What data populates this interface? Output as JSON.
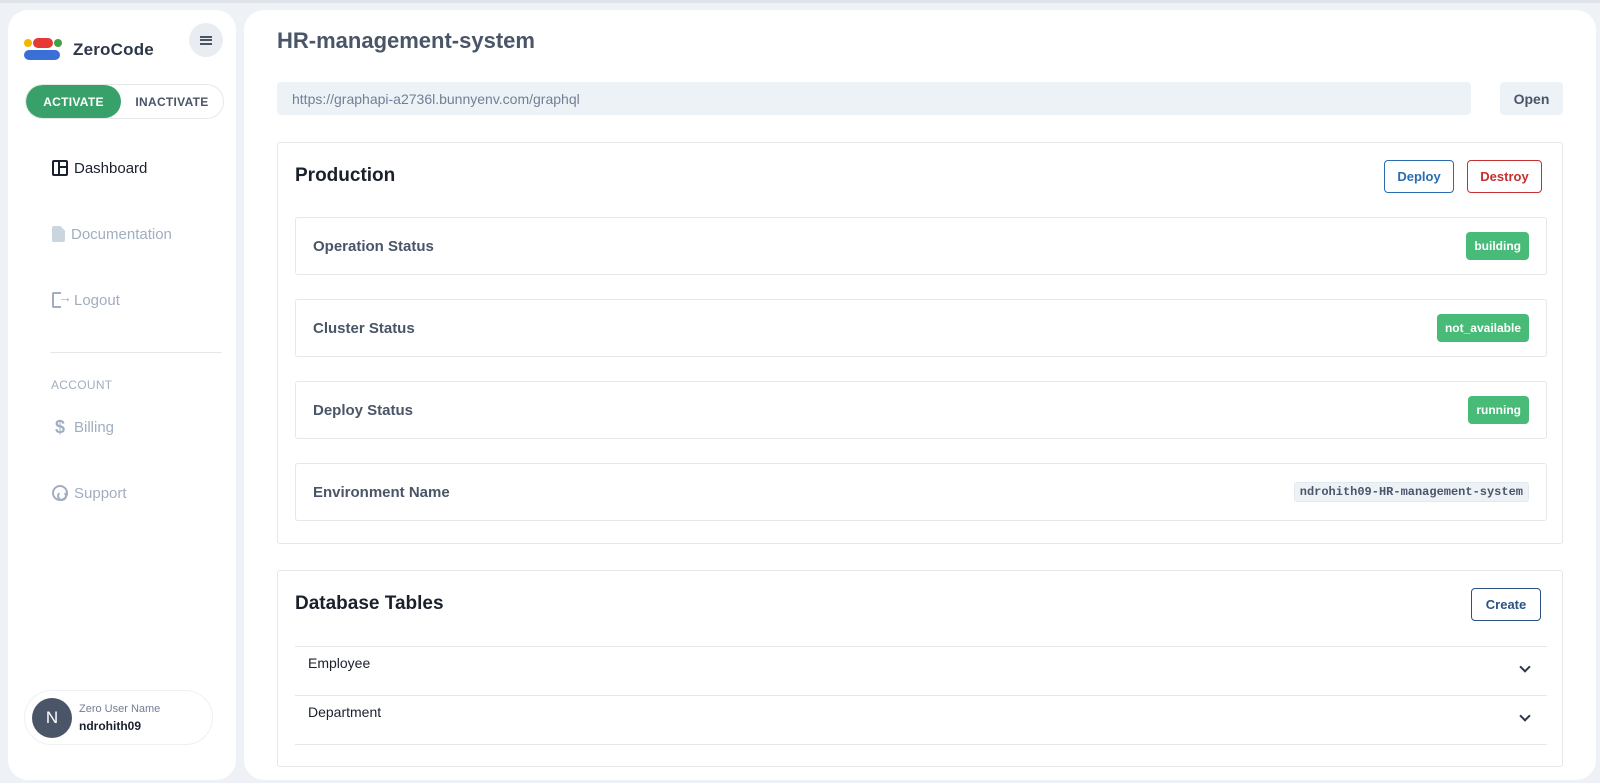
{
  "sidebar": {
    "brand": "ZeroCode",
    "toggle": {
      "activate": "ACTIVATE",
      "inactivate": "INACTIVATE"
    },
    "nav": [
      {
        "label": "Dashboard",
        "icon": "dashboard-icon",
        "active": true
      },
      {
        "label": "Documentation",
        "icon": "document-icon",
        "active": false
      },
      {
        "label": "Logout",
        "icon": "logout-icon",
        "active": false
      }
    ],
    "account_section": "ACCOUNT",
    "account_nav": [
      {
        "label": "Billing",
        "icon": "dollar-icon"
      },
      {
        "label": "Support",
        "icon": "support-icon"
      }
    ],
    "user": {
      "initial": "N",
      "label": "Zero User Name",
      "name": "ndrohith09"
    }
  },
  "main": {
    "title": "HR-management-system",
    "url": "https://graphapi-a2736l.bunnyenv.com/graphql",
    "open_label": "Open",
    "production": {
      "title": "Production",
      "deploy_label": "Deploy",
      "destroy_label": "Destroy",
      "rows": [
        {
          "label": "Operation Status",
          "value": "building"
        },
        {
          "label": "Cluster Status",
          "value": "not_available"
        },
        {
          "label": "Deploy Status",
          "value": "running"
        },
        {
          "label": "Environment Name",
          "value": "ndrohith09-HR-management-system"
        }
      ]
    },
    "database": {
      "title": "Database Tables",
      "create_label": "Create",
      "tables": [
        {
          "name": "Employee"
        },
        {
          "name": "Department"
        }
      ]
    }
  },
  "colors": {
    "accent_green": "#38a169",
    "badge_green": "#48bb78",
    "deploy_blue": "#2b6cb0",
    "destroy_red": "#c53030",
    "background": "#eef1f5"
  }
}
